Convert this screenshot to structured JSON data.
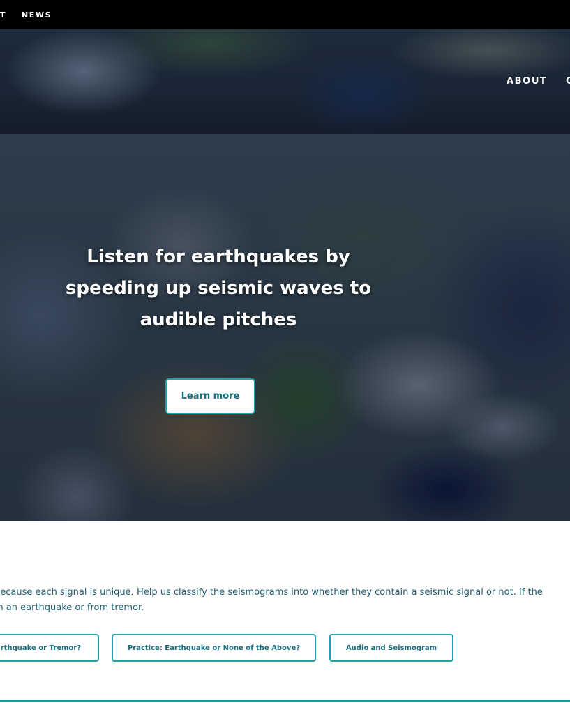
{
  "topbar": {
    "items": [
      "T",
      "NEWS"
    ]
  },
  "header": {
    "nav": [
      "ABOUT",
      "C"
    ]
  },
  "hero": {
    "title_lines": [
      "Listen for earthquakes by",
      "speeding up seismic waves to",
      "audible pitches"
    ],
    "button_label": "Learn more"
  },
  "intro": {
    "lines": [
      "because each signal is unique. Help us classify the seismograms into whether they contain a seismic signal or not. If the",
      "m an earthquake or from tremor."
    ]
  },
  "project_buttons": [
    "arthquake or Tremor?",
    "Practice: Earthquake or None of the Above?",
    "Audio and Seismogram"
  ],
  "colors": {
    "accent": "#1fa2aa",
    "text_teal": "#1b6f80",
    "topbar_bg": "#000000"
  }
}
